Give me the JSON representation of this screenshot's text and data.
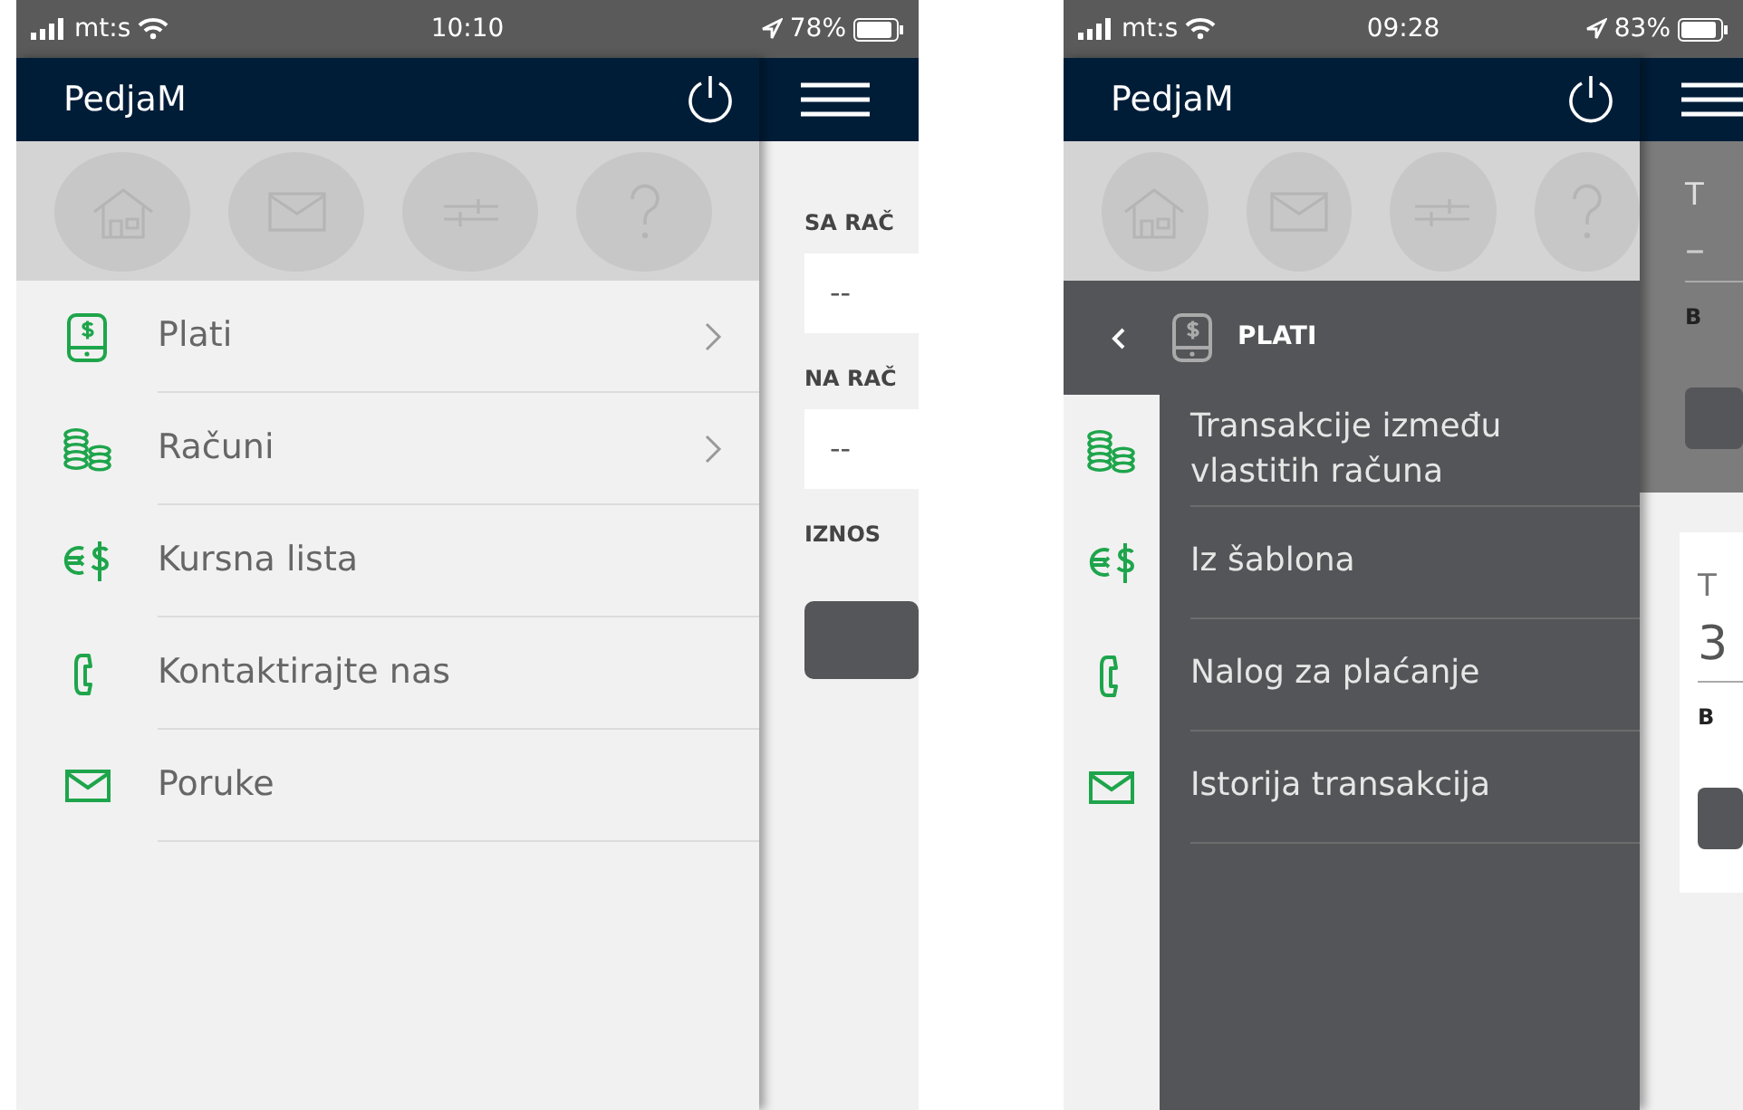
{
  "phones": [
    {
      "status_bar": {
        "carrier": "mt:s",
        "time": "10:10",
        "battery": "78%"
      },
      "app_bar": {
        "title": "PedjaM"
      },
      "drawer": {
        "kind": "main",
        "items": [
          {
            "label": "Plati",
            "has_submenu": true
          },
          {
            "label": "Računi",
            "has_submenu": true
          },
          {
            "label": "Kursna lista",
            "has_submenu": false
          },
          {
            "label": "Kontaktirajte nas",
            "has_submenu": false
          },
          {
            "label": "Poruke",
            "has_submenu": false
          }
        ]
      },
      "page": {
        "kind": "form",
        "fields": [
          {
            "label": "SA RAČ",
            "value": "--"
          },
          {
            "label": "NA RAČ",
            "value": "--"
          },
          {
            "label": "IZNOS"
          }
        ]
      }
    },
    {
      "status_bar": {
        "carrier": "mt:s",
        "time": "09:28",
        "battery": "83%"
      },
      "app_bar": {
        "title": "PedjaM"
      },
      "drawer": {
        "kind": "submenu",
        "title": "PLATI",
        "items": [
          {
            "label": "Transakcije između vlastitih računa"
          },
          {
            "label": "Iz šablona"
          },
          {
            "label": "Nalog za plaćanje"
          },
          {
            "label": "Istorija transakcija"
          }
        ]
      },
      "page": {
        "kind": "overview",
        "sections": [
          {
            "dimmed": true,
            "title": "T",
            "value": "–",
            "caption": "B"
          },
          {
            "dimmed": false,
            "title": "T",
            "value": "3",
            "caption": "B"
          }
        ]
      }
    }
  ]
}
